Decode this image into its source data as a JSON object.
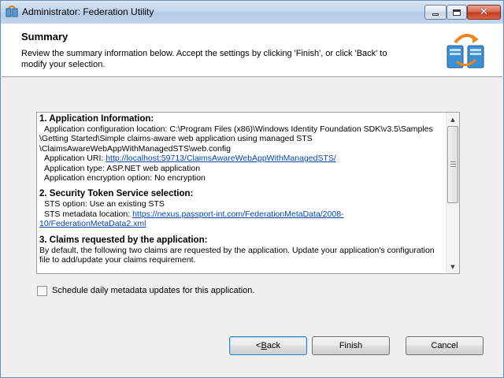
{
  "window": {
    "title": "Administrator: Federation Utility"
  },
  "header": {
    "title": "Summary",
    "description": "Review the summary information below. Accept the settings by clicking 'Finish', or click 'Back' to modify your selection.",
    "icon": "federation-servers-icon"
  },
  "summary": {
    "section1": {
      "heading": "1. Application Information:",
      "config_line1": "Application configuration location: C:\\Program Files (x86)\\Windows Identity Foundation SDK\\v3.5\\Samples",
      "config_line2": "\\Getting Started\\Simple claims-aware web application using managed STS",
      "config_line3": "\\ClaimsAwareWebAppWithManagedSTS\\web.config",
      "uri_label": "Application URI: ",
      "uri_value": "http://localhost:59713/ClaimsAwareWebAppWithManagedSTS/",
      "type": "Application type: ASP.NET web application",
      "encryption": "Application encryption option: No encryption"
    },
    "section2": {
      "heading": "2. Security Token Service selection:",
      "sts_option": "STS option: Use an existing STS",
      "metadata_label": "STS metadata location: ",
      "metadata_line1": "https://nexus.passport-int.com/FederationMetaData/2008-",
      "metadata_line2": "10/FederationMetaData2.xml"
    },
    "section3": {
      "heading": "3. Claims requested by the application:",
      "line1": "By default, the following two claims are requested by the application. Update your application's configuration",
      "line2": "file to add/update your claims requirement."
    }
  },
  "checkbox": {
    "label": "Schedule daily metadata updates for this application.",
    "checked": false
  },
  "buttons": {
    "back_prefix": "< ",
    "back_accel": "B",
    "back_rest": "ack",
    "finish": "Finish",
    "cancel": "Cancel"
  },
  "colors": {
    "link": "#0645ad",
    "window_bg": "#f0f0f0",
    "close_button": "#c43b20"
  }
}
